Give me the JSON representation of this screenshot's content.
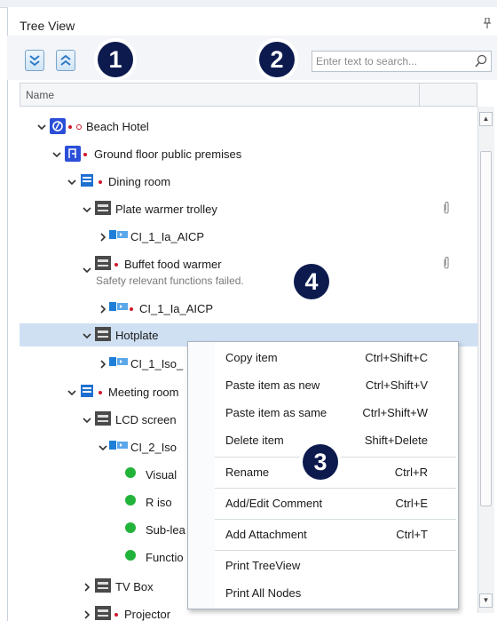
{
  "panel": {
    "title": "Tree View",
    "pin_icon": "pin-icon"
  },
  "toolbar": {
    "expand_all_icon": "expand-all-icon",
    "collapse_all_icon": "collapse-all-icon"
  },
  "search": {
    "placeholder": "Enter text to search...",
    "value": "",
    "icon": "search-icon"
  },
  "header": {
    "column_name": "Name"
  },
  "callouts": [
    "1",
    "2",
    "3",
    "4"
  ],
  "tree": {
    "nodes": [
      {
        "label": "Beach Hotel",
        "level": 0,
        "icon": "site-icon",
        "expanded": true
      },
      {
        "label": "Ground floor public premises",
        "level": 1,
        "icon": "floor-icon",
        "expanded": true
      },
      {
        "label": "Dining room",
        "level": 2,
        "icon": "room-icon",
        "expanded": true
      },
      {
        "label": "Plate warmer trolley",
        "level": 3,
        "icon": "device-icon",
        "expanded": true,
        "attachment": true
      },
      {
        "label": "CI_1_Ia_AICP",
        "level": 4,
        "icon": "circuit-icon",
        "expanded": false
      },
      {
        "label": "Buffet food warmer",
        "level": 3,
        "icon": "device-icon",
        "expanded": true,
        "attachment": true,
        "comment": "Safety relevant functions failed."
      },
      {
        "label": "CI_1_Ia_AICP",
        "level": 4,
        "icon": "circuit-icon",
        "expanded": false
      },
      {
        "label": "Hotplate",
        "level": 3,
        "icon": "device-icon",
        "expanded": true,
        "selected": true
      },
      {
        "label": "CI_1_Iso_",
        "level": 4,
        "icon": "circuit-icon",
        "expanded": false
      },
      {
        "label": "Meeting room",
        "level": 2,
        "icon": "room-icon",
        "expanded": true
      },
      {
        "label": "LCD screen",
        "level": 3,
        "icon": "device-icon",
        "expanded": true
      },
      {
        "label": "CI_2_Iso",
        "level": 4,
        "icon": "circuit-icon",
        "expanded": true
      },
      {
        "label": "Visual",
        "level": 5,
        "icon": "pass-icon"
      },
      {
        "label": "R iso",
        "level": 5,
        "icon": "pass-icon"
      },
      {
        "label": "Sub-lea",
        "level": 5,
        "icon": "pass-icon"
      },
      {
        "label": "Functio",
        "level": 5,
        "icon": "pass-icon"
      },
      {
        "label": "TV Box",
        "level": 3,
        "icon": "device-icon",
        "expanded": false
      },
      {
        "label": "Projector",
        "level": 3,
        "icon": "device-icon",
        "expanded": false
      }
    ]
  },
  "context_menu": {
    "items": [
      {
        "label": "Copy item",
        "shortcut": "Ctrl+Shift+C"
      },
      {
        "label": "Paste item as new",
        "shortcut": "Ctrl+Shift+V"
      },
      {
        "label": "Paste item as same",
        "shortcut": "Ctrl+Shift+W"
      },
      {
        "label": "Delete item",
        "shortcut": "Shift+Delete"
      },
      {
        "label": "Rename",
        "shortcut": "Ctrl+R"
      },
      {
        "label": "Add/Edit Comment",
        "shortcut": "Ctrl+E"
      },
      {
        "label": "Add Attachment",
        "shortcut": "Ctrl+T"
      },
      {
        "label": "Print TreeView",
        "shortcut": ""
      },
      {
        "label": "Print All Nodes",
        "shortcut": ""
      }
    ]
  },
  "colors": {
    "callout": "#0c1a4e",
    "selection": "#cfe0f3",
    "status_red": "#d1182b",
    "status_green": "#22b33a",
    "device_icon": "#4a4a4a",
    "room_icon": "#1f6fd1"
  }
}
